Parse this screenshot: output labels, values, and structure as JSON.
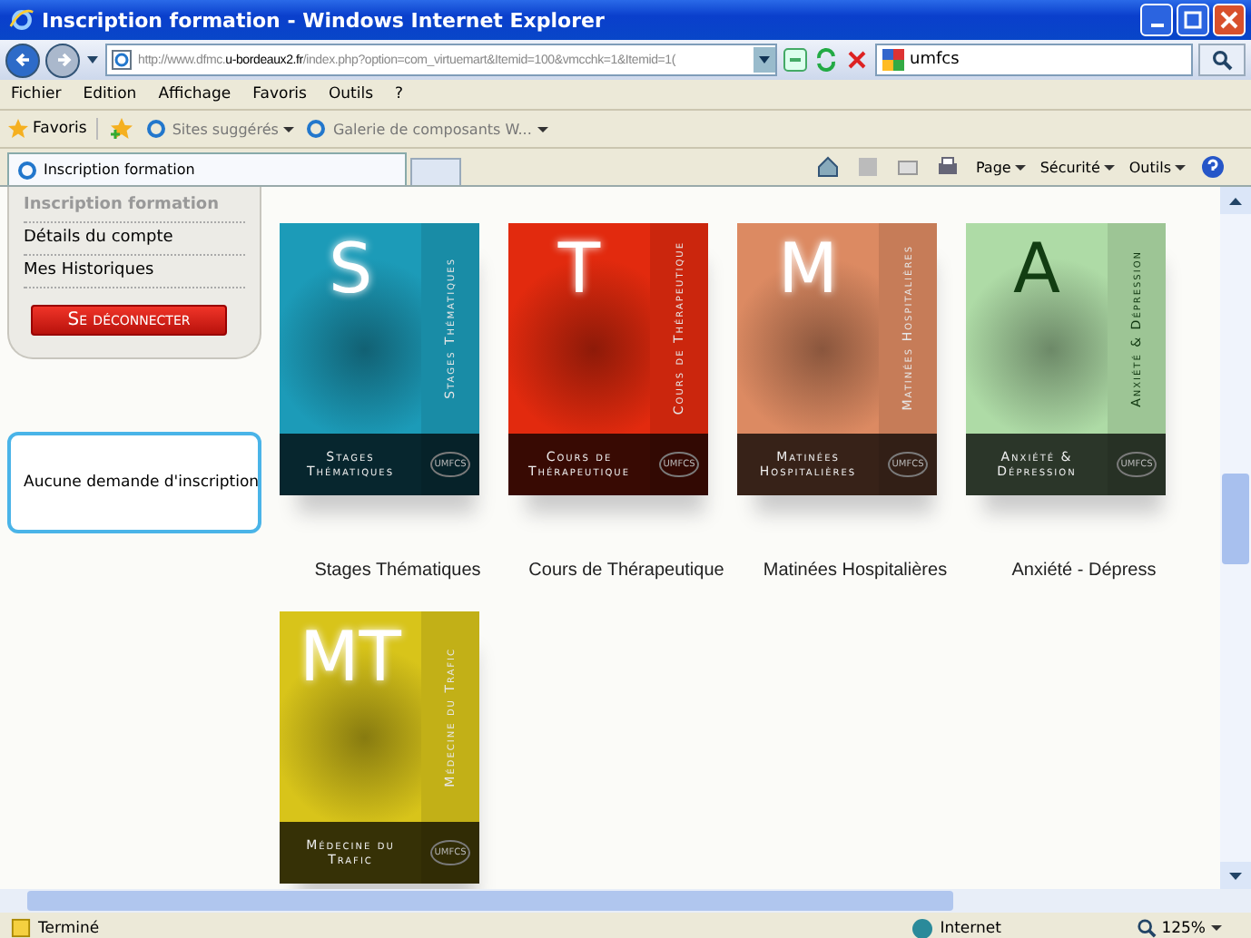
{
  "window": {
    "title": "Inscription formation - Windows Internet Explorer"
  },
  "address_bar": {
    "url_prefix": "http://www.dfmc.",
    "url_domain": "u-bordeaux2.fr",
    "url_path": "/index.php?option=com_virtuemart&Itemid=100&vmcchk=1&Itemid=1("
  },
  "search": {
    "value": "umfcs"
  },
  "menu": [
    "Fichier",
    "Edition",
    "Affichage",
    "Favoris",
    "Outils",
    "?"
  ],
  "favorites_bar": {
    "label": "Favoris",
    "links": [
      "Sites suggérés",
      "Galerie de composants W..."
    ]
  },
  "tab": {
    "label": "Inscription formation"
  },
  "commands": [
    "Page",
    "Sécurité",
    "Outils"
  ],
  "sidebar": {
    "items": [
      {
        "label": "Inscription formation",
        "disabled": true
      },
      {
        "label": "Détails du compte",
        "disabled": false
      },
      {
        "label": "Mes Historiques",
        "disabled": false
      }
    ],
    "logout": "Se déconnecter",
    "notice": "Aucune demande d'inscription"
  },
  "products": [
    {
      "letter": "S",
      "side_text": "Stages Thématiques",
      "front_text": "Stages Thématiques",
      "logo": "UMFCS",
      "caption": "Stages Thématiques",
      "color": "#1c9bb8"
    },
    {
      "letter": "T",
      "side_text": "Cours de Thérapeutique",
      "front_text": "Cours de Thérapeutique",
      "logo": "UMFCS",
      "caption": "Cours de Thérapeutique",
      "color": "#e22a0e"
    },
    {
      "letter": "M",
      "side_text": "Matinées Hospitalières",
      "front_text": "Matinées Hospitalières",
      "logo": "UMFCS",
      "caption": "Matinées Hospitalières",
      "color": "#dc8a62"
    },
    {
      "letter": "A",
      "side_text": "Anxiété & Dépression",
      "front_text": "Anxiété & Dépression",
      "logo": "UMFCS",
      "caption": "Anxiété - Dépress",
      "color": "#aedba6"
    },
    {
      "letter": "MT",
      "side_text": "Médecine du Trafic",
      "front_text": "Médecine du Trafic",
      "logo": "UMFCS",
      "color": "#d8c41a"
    }
  ],
  "status_bar": {
    "text": "Terminé",
    "zone": "Internet",
    "zoom": "125%"
  }
}
